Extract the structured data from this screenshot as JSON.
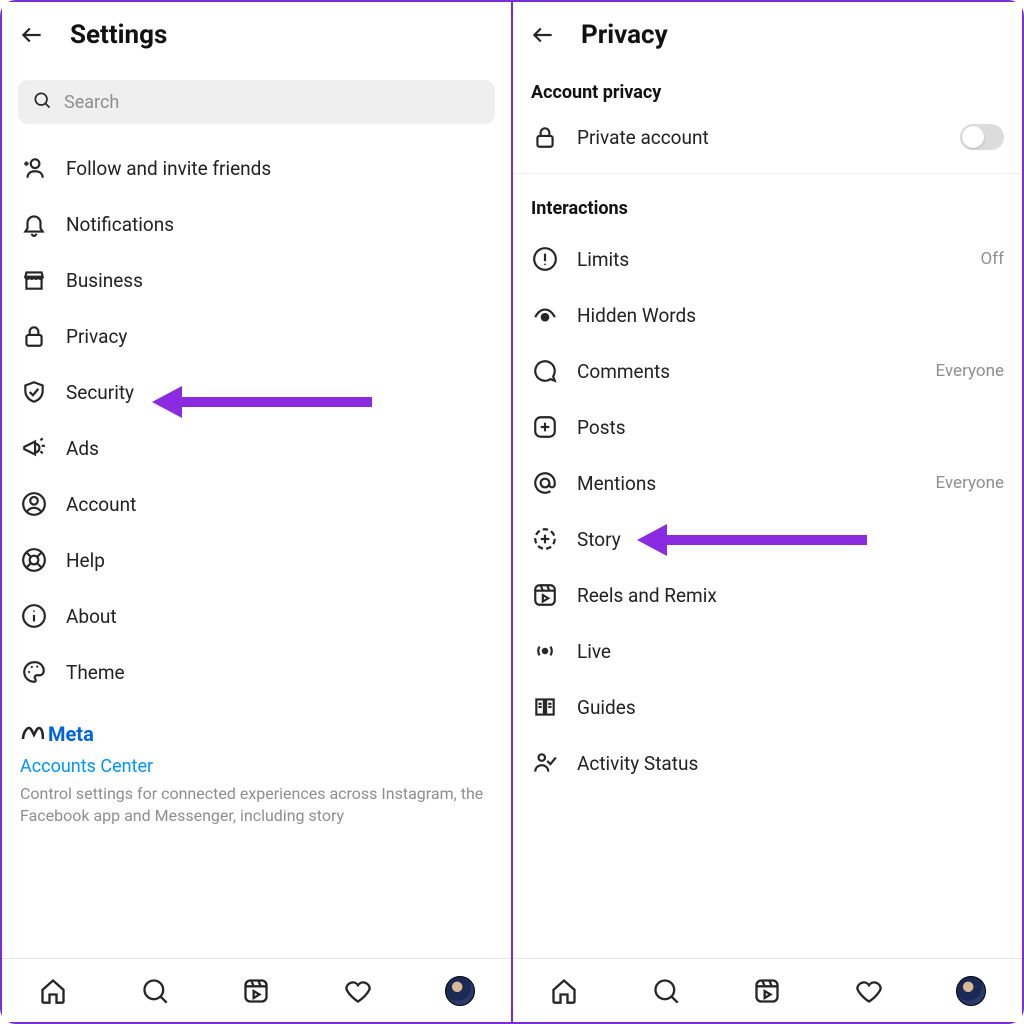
{
  "left": {
    "title": "Settings",
    "search_placeholder": "Search",
    "items": [
      {
        "label": "Follow and invite friends"
      },
      {
        "label": "Notifications"
      },
      {
        "label": "Business"
      },
      {
        "label": "Privacy"
      },
      {
        "label": "Security"
      },
      {
        "label": "Ads"
      },
      {
        "label": "Account"
      },
      {
        "label": "Help"
      },
      {
        "label": "About"
      },
      {
        "label": "Theme"
      }
    ],
    "meta_brand": "Meta",
    "accounts_center": "Accounts Center",
    "meta_desc": "Control settings for connected experiences across Instagram, the Facebook app and Messenger, including story"
  },
  "right": {
    "title": "Privacy",
    "section1": "Account privacy",
    "private_account": "Private account",
    "section2": "Interactions",
    "items": [
      {
        "label": "Limits",
        "trail": "Off"
      },
      {
        "label": "Hidden Words",
        "trail": ""
      },
      {
        "label": "Comments",
        "trail": "Everyone"
      },
      {
        "label": "Posts",
        "trail": ""
      },
      {
        "label": "Mentions",
        "trail": "Everyone"
      },
      {
        "label": "Story",
        "trail": ""
      },
      {
        "label": "Reels and Remix",
        "trail": ""
      },
      {
        "label": "Live",
        "trail": ""
      },
      {
        "label": "Guides",
        "trail": ""
      },
      {
        "label": "Activity Status",
        "trail": ""
      }
    ]
  }
}
